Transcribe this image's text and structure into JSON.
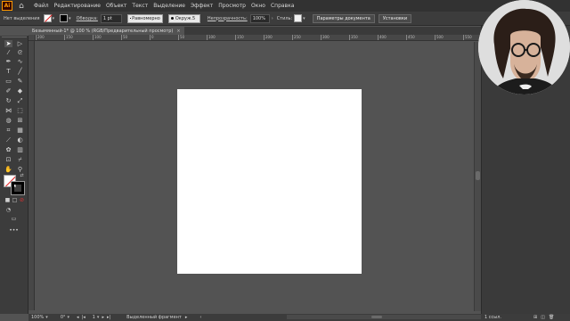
{
  "app": {
    "logo_text": "Ai"
  },
  "menu": {
    "items": [
      "Файл",
      "Редактирование",
      "Объект",
      "Текст",
      "Выделение",
      "Эффект",
      "Просмотр",
      "Окно",
      "Справка"
    ]
  },
  "control_bar": {
    "no_selection": "Нет выделения",
    "stroke_label": "Обводка:",
    "stroke_weight": "1 pt",
    "brush_label": "Равномерно",
    "profile_label": "Окруж.5",
    "opacity_label": "Непрозрачность:",
    "opacity_value": "100%",
    "style_label": "Стиль:",
    "doc_settings_button": "Параметры документа",
    "preferences_button": "Установки"
  },
  "document": {
    "tab_title": "Безымянный-1* @ 100 % (RGB/Предварительный просмотр)",
    "close_glyph": "×"
  },
  "ruler": {
    "h_ticks": [
      "200",
      "150",
      "100",
      "50",
      "0",
      "50",
      "100",
      "150",
      "200",
      "250",
      "300",
      "350",
      "400",
      "450",
      "500",
      "550"
    ]
  },
  "status_bar": {
    "zoom": "100%",
    "rotation": "0°",
    "artboard_number": "1",
    "selection_tool": "Выделенный фрагмент",
    "right_value": "1 ссыл."
  },
  "colors": {
    "accent": "#ff9a00",
    "bg": "#535353",
    "artboard": "#ffffff"
  },
  "icons": [
    "home-icon",
    "selection-tool-icon",
    "direct-selection-icon",
    "magic-wand-icon",
    "lasso-icon",
    "pen-icon",
    "curvature-icon",
    "type-icon",
    "line-icon",
    "rectangle-icon",
    "paintbrush-icon",
    "pencil-icon",
    "eraser-icon",
    "rotate-icon",
    "scale-icon",
    "width-icon",
    "free-transform-icon",
    "shape-builder-icon",
    "perspective-grid-icon",
    "mesh-icon",
    "gradient-icon",
    "eyedropper-icon",
    "blend-icon",
    "symbol-sprayer-icon",
    "graph-icon",
    "artboard-icon",
    "slice-icon",
    "hand-icon",
    "zoom-icon",
    "fill-stroke-icon",
    "swap-icon",
    "screen-mode-icon",
    "more-tools-icon"
  ]
}
